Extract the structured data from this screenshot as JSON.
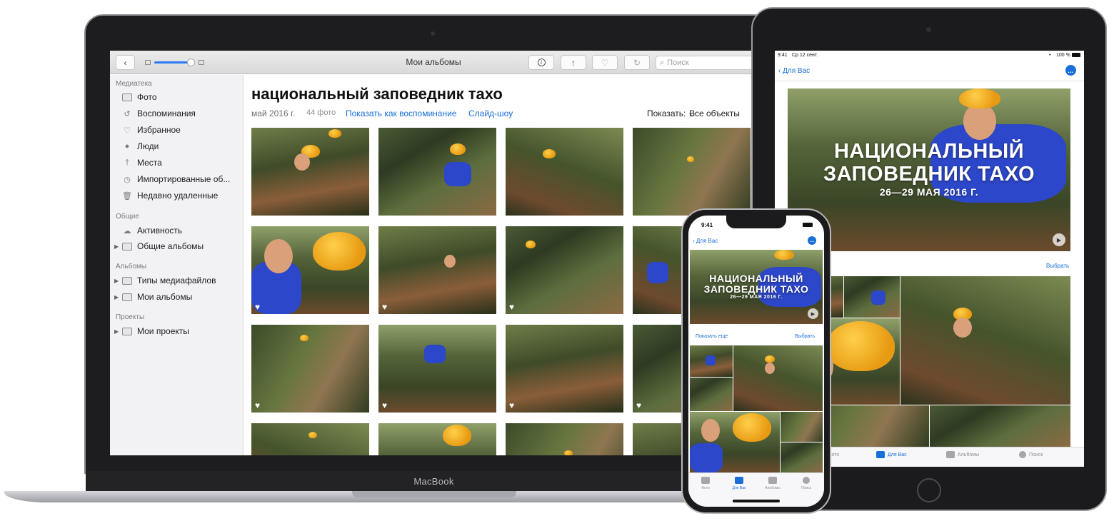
{
  "macbook": {
    "brand": "MacBook",
    "toolbar": {
      "title": "Мои альбомы",
      "back_icon": "chevron-left-icon",
      "info_icon": "info-icon",
      "share_icon": "share-icon",
      "heart_icon": "heart-icon",
      "rotate_icon": "rotate-icon",
      "search_placeholder": "Поиск"
    },
    "sidebar": {
      "sections": [
        {
          "header": "Медиатека",
          "items": [
            {
              "label": "Фото",
              "icon": "photos-icon"
            },
            {
              "label": "Воспоминания",
              "icon": "memories-icon"
            },
            {
              "label": "Избранное",
              "icon": "heart-icon"
            },
            {
              "label": "Люди",
              "icon": "person-icon"
            },
            {
              "label": "Места",
              "icon": "pin-icon"
            },
            {
              "label": "Импортированные об...",
              "icon": "clock-icon"
            },
            {
              "label": "Недавно удаленные",
              "icon": "trash-icon"
            }
          ]
        },
        {
          "header": "Общие",
          "items": [
            {
              "label": "Активность",
              "icon": "cloud-icon"
            },
            {
              "label": "Общие альбомы",
              "icon": "folder-icon"
            }
          ]
        },
        {
          "header": "Альбомы",
          "items": [
            {
              "label": "Типы медиафайлов",
              "icon": "folder-icon"
            },
            {
              "label": "Мои альбомы",
              "icon": "folder-icon"
            }
          ]
        },
        {
          "header": "Проекты",
          "items": [
            {
              "label": "Мои проекты",
              "icon": "folder-icon"
            }
          ]
        }
      ]
    },
    "main": {
      "title": "национальный заповедник тахо",
      "date": "май 2016 г.",
      "count": "44 фото",
      "show_memory": "Показать как воспоминание",
      "slideshow": "Слайд-шоу",
      "show_label": "Показать:",
      "show_value": "Все объекты"
    }
  },
  "ipad": {
    "status_time": "9:41",
    "status_date": "Ср 12 сент.",
    "battery": "100 %",
    "back_label": "Для Вас",
    "hero_line1": "НАЦИОНАЛЬНЫЙ",
    "hero_line2": "ЗАПОВЕДНИК ТАХО",
    "hero_dates": "26—29 МАЯ 2016 Г.",
    "select": "Выбрать",
    "tabs": [
      "Фото",
      "Для Вас",
      "Альбомы",
      "Поиск"
    ]
  },
  "iphone": {
    "status_time": "9:41",
    "back_label": "Для Вас",
    "hero_line1": "НАЦИОНАЛЬНЫЙ",
    "hero_line2": "ЗАПОВЕДНИК ТАХО",
    "hero_dates": "26—29 МАЯ 2016 Г.",
    "show_more": "Показать еще",
    "select": "Выбрать",
    "tabs": [
      "Фото",
      "Для Вас",
      "Альбомы",
      "Поиск"
    ]
  },
  "colors": {
    "accent": "#1a6ed8",
    "helmet": "#f0a81c"
  }
}
